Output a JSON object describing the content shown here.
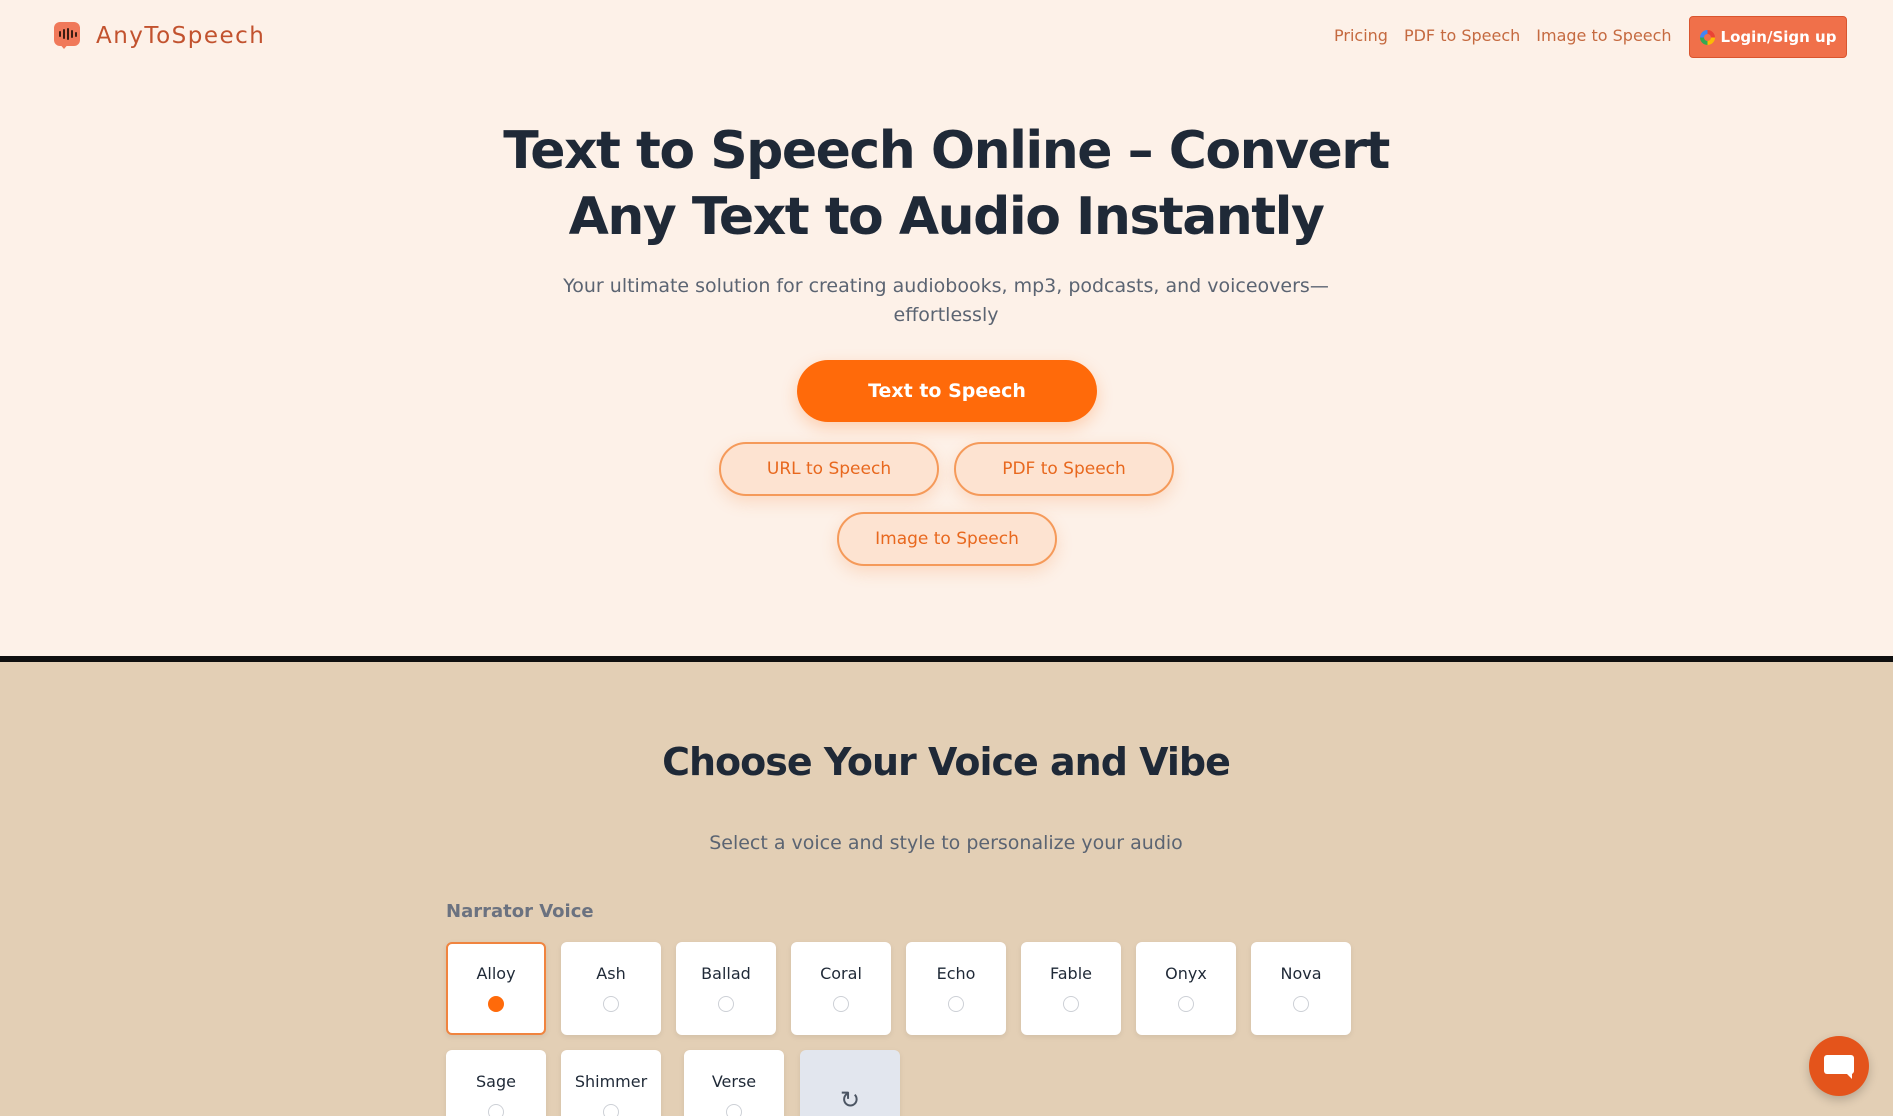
{
  "header": {
    "brand": "AnyToSpeech",
    "nav": [
      {
        "label": "Pricing"
      },
      {
        "label": "PDF to Speech"
      },
      {
        "label": "Image to Speech"
      }
    ],
    "login_label": "Login/Sign up"
  },
  "hero": {
    "title_line1": "Text to Speech Online – Convert",
    "title_line2": "Any Text to Audio Instantly",
    "subtitle_line1": "Your ultimate solution for creating audiobooks, mp3, podcasts, and voiceovers—",
    "subtitle_line2": "effortlessly",
    "primary_cta": "Text to Speech",
    "secondary": [
      {
        "label": "URL to Speech"
      },
      {
        "label": "PDF to Speech"
      },
      {
        "label": "Image to Speech"
      }
    ]
  },
  "voice": {
    "title": "Choose Your Voice and Vibe",
    "subtitle": "Select a voice and style to personalize your audio",
    "narrator_label": "Narrator Voice",
    "selected": "Alloy",
    "options": [
      {
        "name": "Alloy",
        "selected": true
      },
      {
        "name": "Ash",
        "selected": false
      },
      {
        "name": "Ballad",
        "selected": false
      },
      {
        "name": "Coral",
        "selected": false
      },
      {
        "name": "Echo",
        "selected": false
      },
      {
        "name": "Fable",
        "selected": false
      },
      {
        "name": "Onyx",
        "selected": false
      },
      {
        "name": "Nova",
        "selected": false
      },
      {
        "name": "Sage",
        "selected": false
      },
      {
        "name": "Shimmer",
        "selected": false
      },
      {
        "name": "Verse",
        "selected": false
      }
    ],
    "more_icon": "refresh-icon"
  },
  "colors": {
    "accent": "#ff6a0a",
    "brand": "#c2522e",
    "hero_bg": "#fdf1e8",
    "section_bg": "#e3cfb5"
  },
  "icons": {
    "logo": "speech-bubble-waveform-icon",
    "login": "google-icon",
    "chat": "chat-icon"
  }
}
